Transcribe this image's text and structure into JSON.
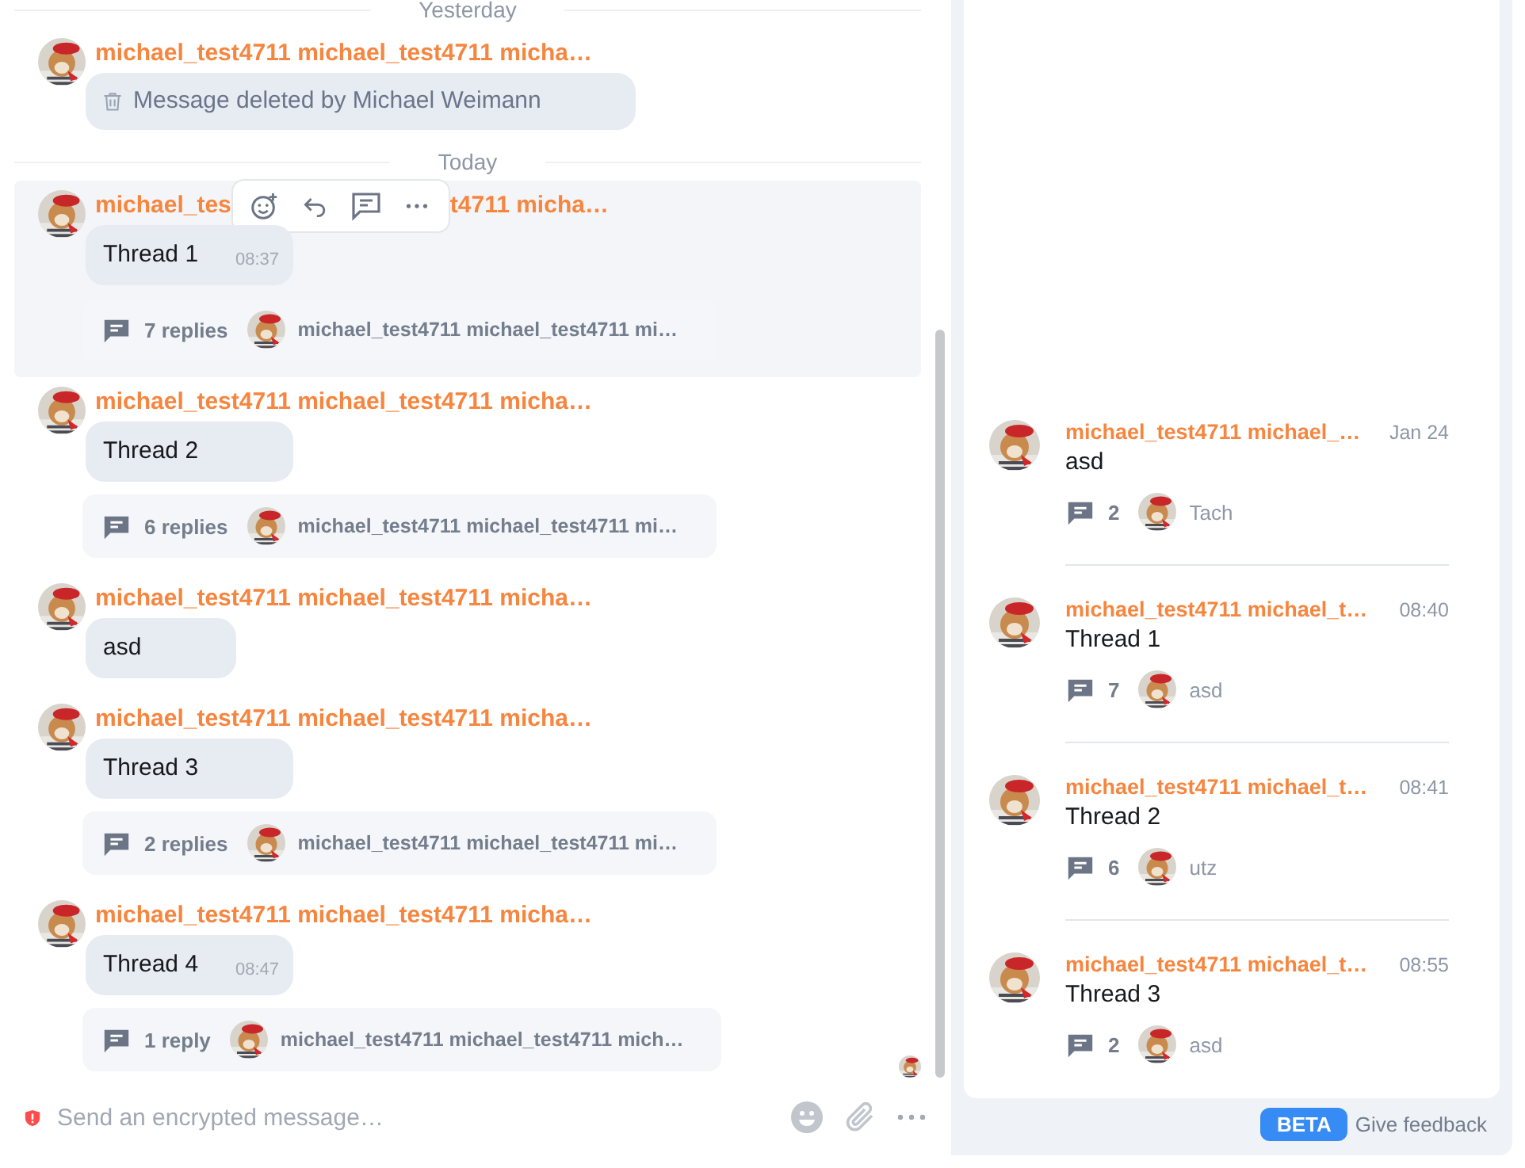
{
  "timeline": [
    {
      "kind": "divider",
      "label": "Yesterday"
    },
    {
      "kind": "deleted",
      "author": "michael_test4711 michael_test4711 micha…",
      "text": "Message deleted by Michael Weimann",
      "highlighted": false
    },
    {
      "kind": "divider",
      "label": "Today"
    },
    {
      "kind": "message",
      "author": "michael_tes",
      "author_rest": "t4711 micha…",
      "text": "Thread 1",
      "time": "08:37",
      "highlighted": true,
      "thread": {
        "replies": "7 replies",
        "last_author": "michael_test4711 michael_test4711 mi…"
      }
    },
    {
      "kind": "message",
      "author": "michael_test4711 michael_test4711 micha…",
      "text": "Thread 2",
      "highlighted": false,
      "thread": {
        "replies": "6 replies",
        "last_author": "michael_test4711 michael_test4711 mi…"
      }
    },
    {
      "kind": "message",
      "author": "michael_test4711 michael_test4711 micha…",
      "text": "asd",
      "highlighted": false
    },
    {
      "kind": "message",
      "author": "michael_test4711 michael_test4711 micha…",
      "text": "Thread 3",
      "highlighted": false,
      "thread": {
        "replies": "2 replies",
        "last_author": "michael_test4711 michael_test4711 mi…"
      }
    },
    {
      "kind": "message",
      "author": "michael_test4711 michael_test4711 micha…",
      "text": "Thread 4",
      "time": "08:47",
      "highlighted": false,
      "thread": {
        "replies": "1 reply",
        "last_author": "michael_test4711 michael_test4711 mich…"
      }
    }
  ],
  "composer": {
    "placeholder": "Send an encrypted message…"
  },
  "threads_panel": {
    "threads": [
      {
        "author": "michael_test4711 michael_…",
        "time": "Jan 24",
        "text": "asd",
        "count": "2",
        "last_reply": "Tach"
      },
      {
        "author": "michael_test4711 michael_t…",
        "time": "08:40",
        "text": "Thread 1",
        "count": "7",
        "last_reply": "asd"
      },
      {
        "author": "michael_test4711 michael_t…",
        "time": "08:41",
        "text": "Thread 2",
        "count": "6",
        "last_reply": "utz"
      },
      {
        "author": "michael_test4711 michael_t…",
        "time": "08:55",
        "text": "Thread 3",
        "count": "2",
        "last_reply": "asd"
      }
    ],
    "badge": "BETA",
    "feedback": "Give feedback"
  }
}
